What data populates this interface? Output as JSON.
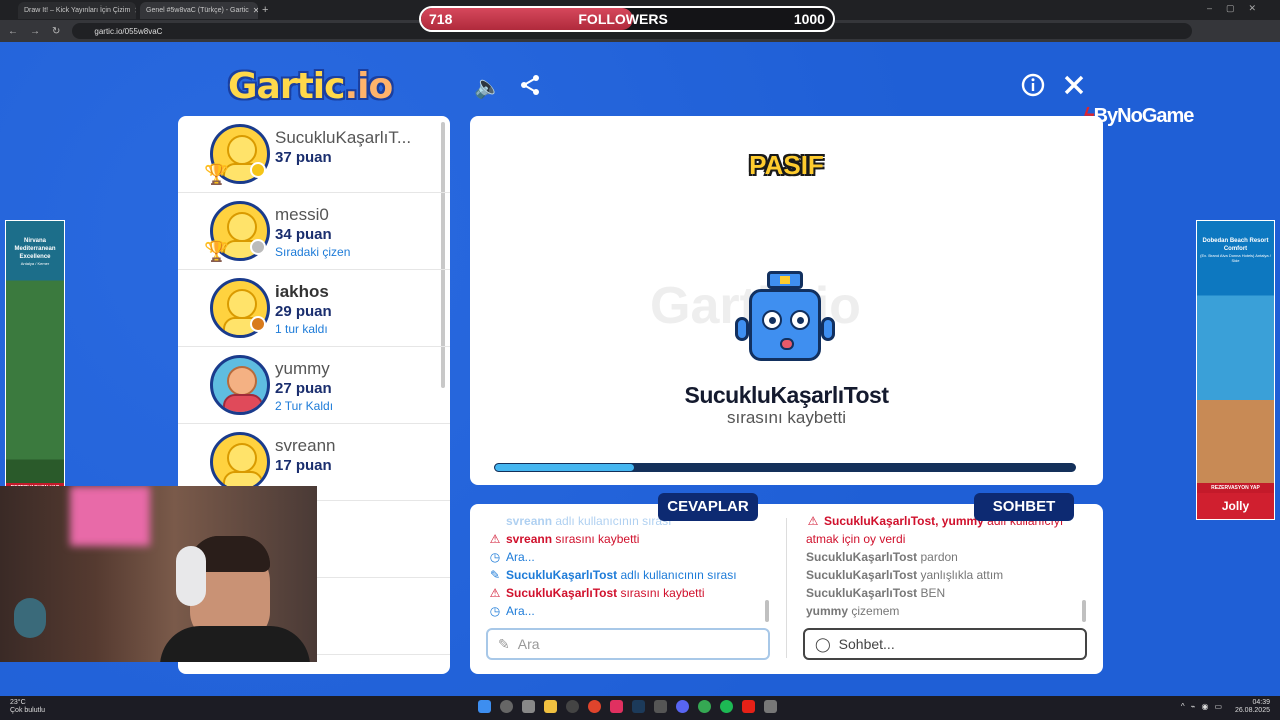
{
  "browser": {
    "tabs": [
      {
        "label": "Draw It! – Kick Yayınları İçin Çizim",
        "active": false
      },
      {
        "label": "Genel #5w8vaC (Türkçe) - Gartic",
        "active": true
      }
    ],
    "url": "gartic.io/055w8vaC"
  },
  "followers": {
    "current": "718",
    "label": "FOLLOWERS",
    "goal": "1000",
    "progress": 0.718
  },
  "header": {
    "logo": "Gartic",
    "logo_suffix": ".io",
    "sponsor": "ByNoGame",
    "icons": [
      "speaker-icon",
      "share-icon",
      "info-icon",
      "close-icon"
    ]
  },
  "ads": {
    "left": {
      "title": "Nirvana Mediterranean Excellence",
      "subtitle": "Antalya / Kemer",
      "cta": "REZERVASYON YAP"
    },
    "right": {
      "title": "Dobedan Beach Resort Comfort",
      "subtitle": "(Ex. Brand Alva Donna Hotels) Antalya / Side",
      "cta": "REZERVASYON YAP",
      "brand": "Jolly"
    }
  },
  "players": [
    {
      "name": "SucukluKaşarlıT...",
      "score": "37 puan",
      "status": "",
      "medal": "#f5c518",
      "trophy": true,
      "avatar": "yellow"
    },
    {
      "name": "messi0",
      "score": "34 puan",
      "status": "Sıradaki çizen",
      "medal": "#bbbbbb",
      "trophy": true,
      "avatar": "yellow"
    },
    {
      "name": "iakhos",
      "score": "29 puan",
      "status": "1 tur kaldı",
      "medal": "#d87a1c",
      "trophy": false,
      "avatar": "yellow"
    },
    {
      "name": "yummy",
      "score": "27 puan",
      "status": "2 Tur Kaldı",
      "medal": "",
      "trophy": false,
      "avatar": "human"
    },
    {
      "name": "svreann",
      "score": "17 puan",
      "status": "",
      "medal": "",
      "trophy": false,
      "avatar": "yellow"
    }
  ],
  "canvas": {
    "state": "PASIF",
    "watermark": "Gartic.io",
    "lost_player": "SucukluKaşarlıTost",
    "lost_text": "sırasını kaybetti",
    "timer_progress": 0.24
  },
  "answers": {
    "label": "CEVAPLAR",
    "placeholder": "Ara",
    "messages": [
      {
        "icon": "",
        "bold": "svreann",
        "text": " adlı kullanıcının sırası",
        "color": "blue",
        "fade": true
      },
      {
        "icon": "⚠",
        "bold": "svreann",
        "text": " sırasını kaybetti",
        "color": "red",
        "fade": false
      },
      {
        "icon": "◷",
        "bold": "",
        "text": "Ara...",
        "color": "blue",
        "fade": false
      },
      {
        "icon": "✎",
        "bold": "SucukluKaşarlıTost",
        "text": " adlı kullanıcının sırası",
        "color": "blue",
        "fade": false
      },
      {
        "icon": "⚠",
        "bold": "SucukluKaşarlıTost",
        "text": " sırasını kaybetti",
        "color": "red",
        "fade": false
      },
      {
        "icon": "◷",
        "bold": "",
        "text": "Ara...",
        "color": "blue",
        "fade": false
      }
    ]
  },
  "chat": {
    "label": "SOHBET",
    "placeholder": "Sohbet...",
    "messages": [
      {
        "icon": "⚠",
        "bold": "SucukluKaşarlıTost, yummy",
        "text": " adlı kullanıcıyı",
        "color": "red"
      },
      {
        "icon": "",
        "bold": "",
        "text": "atmak için oy verdi",
        "color": "red"
      },
      {
        "icon": "",
        "bold": "SucukluKaşarlıTost",
        "text": " pardon",
        "color": "grey"
      },
      {
        "icon": "",
        "bold": "SucukluKaşarlıTost",
        "text": " yanlışlıkla attım",
        "color": "grey"
      },
      {
        "icon": "",
        "bold": "SucukluKaşarlıTost",
        "text": " BEN",
        "color": "grey"
      },
      {
        "icon": "",
        "bold": "yummy",
        "text": " çizemem",
        "color": "grey"
      }
    ]
  },
  "taskbar": {
    "temp": "23°C",
    "weather": "Çok bulutlu",
    "time": "04:39",
    "date": "26.08.2025"
  }
}
